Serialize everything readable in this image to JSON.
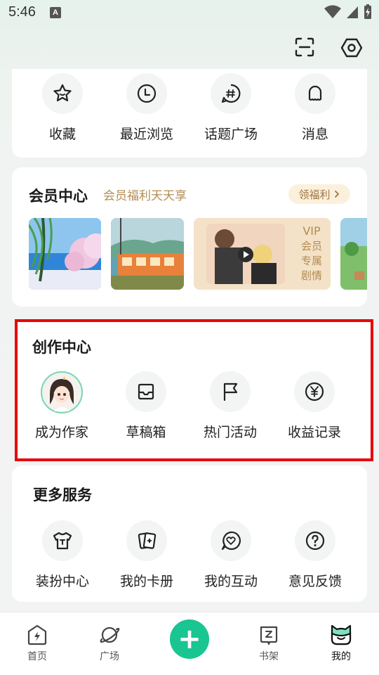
{
  "status_bar": {
    "time": "5:46",
    "a_badge": "A"
  },
  "quick_actions": [
    {
      "label": "收藏",
      "icon": "star-icon"
    },
    {
      "label": "最近浏览",
      "icon": "clock-icon"
    },
    {
      "label": "话题广场",
      "icon": "hashtag-icon"
    },
    {
      "label": "消息",
      "icon": "bell-icon"
    }
  ],
  "vip": {
    "title": "会员中心",
    "subtitle": "会员福利天天享",
    "benefit_button": "领福利",
    "promo_text": "VIP会员专属剧情",
    "promo_lines": [
      "VIP",
      "会员",
      "专属",
      "剧情"
    ]
  },
  "creation": {
    "title": "创作中心",
    "items": [
      {
        "label": "成为作家",
        "icon": "avatar-icon"
      },
      {
        "label": "草稿箱",
        "icon": "inbox-icon"
      },
      {
        "label": "热门活动",
        "icon": "flag-icon"
      },
      {
        "label": "收益记录",
        "icon": "yen-icon"
      }
    ]
  },
  "services": {
    "title": "更多服务",
    "items": [
      {
        "label": "装扮中心",
        "icon": "tshirt-icon"
      },
      {
        "label": "我的卡册",
        "icon": "cards-icon"
      },
      {
        "label": "我的互动",
        "icon": "chat-heart-icon"
      },
      {
        "label": "意见反馈",
        "icon": "question-icon"
      }
    ]
  },
  "bottom_nav": {
    "items": [
      {
        "label": "首页"
      },
      {
        "label": "广场"
      },
      {
        "label": "书架"
      },
      {
        "label": "我的"
      }
    ],
    "add_symbol": "+"
  },
  "colors": {
    "accent": "#19c590",
    "gold": "#b48c52",
    "highlight_border": "#e8000b"
  }
}
